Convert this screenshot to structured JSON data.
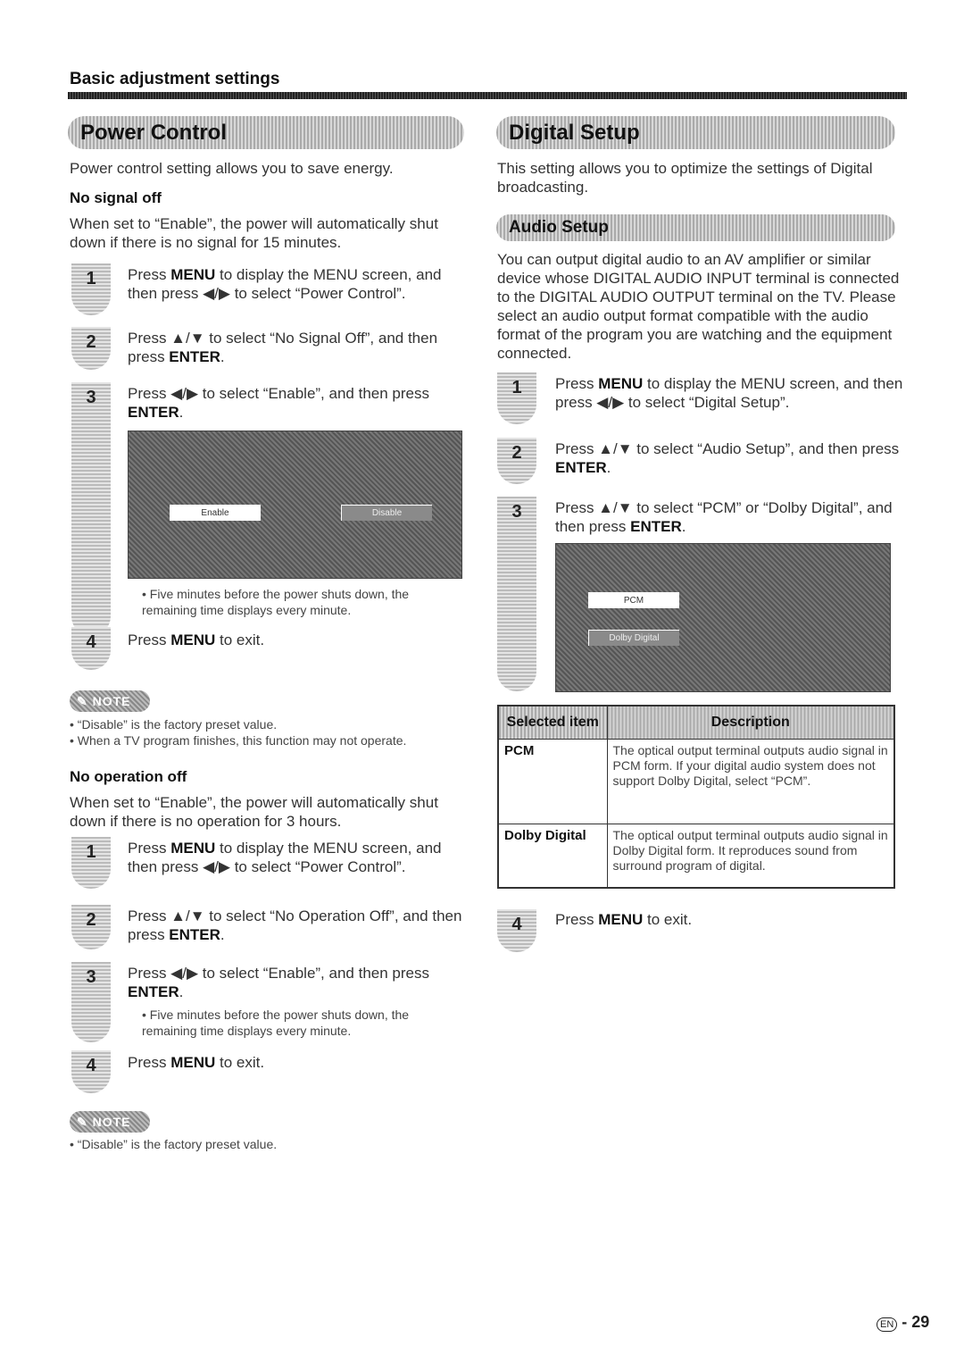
{
  "header": {
    "title": "Basic adjustment settings"
  },
  "power_control": {
    "title": "Power Control",
    "intro": "Power control setting allows you to save energy.",
    "no_signal": {
      "heading": "No signal off",
      "desc": "When set to “Enable”, the power will automatically shut down if there is no signal for 15 minutes.",
      "steps": [
        {
          "num": "1",
          "pre": "Press ",
          "key": "MENU",
          "post": " to display the MENU screen, and then press ◀/▶ to select “Power Control”."
        },
        {
          "num": "2",
          "pre": "Press ▲/▼ to select “No Signal Off”, and then press ",
          "key": "ENTER",
          "post": "."
        },
        {
          "num": "3",
          "pre": "Press ◀/▶ to select “Enable”, and then press ",
          "key": "ENTER",
          "post": "."
        },
        {
          "num": "4",
          "pre": "Press ",
          "key": "MENU",
          "post": " to exit."
        }
      ],
      "screen": {
        "option_on": "Enable",
        "option_off": "Disable"
      },
      "bullet": "Five minutes before the power shuts down, the remaining time displays every minute.",
      "note_label": "NOTE",
      "notes": [
        "“Disable” is the factory preset value.",
        "When a TV program finishes, this function may not operate."
      ]
    },
    "no_operation": {
      "heading": "No operation off",
      "desc": "When set to “Enable”, the power will automatically shut down if there is no operation for 3 hours.",
      "steps": [
        {
          "num": "1",
          "pre": "Press ",
          "key": "MENU",
          "post": " to display the MENU screen, and then press ◀/▶ to select “Power Control”."
        },
        {
          "num": "2",
          "pre": "Press ▲/▼ to select “No Operation Off”, and then press ",
          "key": "ENTER",
          "post": "."
        },
        {
          "num": "3",
          "pre": "Press ◀/▶ to select “Enable”, and then press ",
          "key": "ENTER",
          "post": "."
        },
        {
          "num": "4",
          "pre": "Press ",
          "key": "MENU",
          "post": " to exit."
        }
      ],
      "bullet": "Five minutes before the power shuts down, the remaining time displays every minute.",
      "note_label": "NOTE",
      "notes": [
        "“Disable” is the factory preset value."
      ]
    }
  },
  "digital_setup": {
    "title": "Digital Setup",
    "intro": "This setting allows you to optimize the settings of Digital broadcasting.",
    "audio_setup": {
      "title": "Audio Setup",
      "desc": "You can output digital audio to an AV amplifier or similar device whose DIGITAL AUDIO INPUT terminal is connected to the DIGITAL AUDIO OUTPUT terminal on the TV. Please select an audio output format compatible with the audio format of the program you are watching and the equipment connected.",
      "steps": [
        {
          "num": "1",
          "pre": "Press ",
          "key": "MENU",
          "post": " to display the MENU screen, and then press ◀/▶ to select “Digital Setup”."
        },
        {
          "num": "2",
          "pre": "Press ▲/▼ to select “Audio Setup”, and then press ",
          "key": "ENTER",
          "post": "."
        },
        {
          "num": "3",
          "pre": "Press ▲/▼ to select “PCM” or “Dolby Digital”, and then press ",
          "key": "ENTER",
          "post": "."
        },
        {
          "num": "4",
          "pre": "Press ",
          "key": "MENU",
          "post": " to exit."
        }
      ],
      "screen": {
        "option_on": "PCM",
        "option_off": "Dolby Digital"
      },
      "table": {
        "headers": [
          "Selected item",
          "Description"
        ],
        "rows": [
          {
            "item": "PCM",
            "desc": "The optical output terminal outputs audio signal in PCM form. If your digital audio system does not support Dolby Digital, select “PCM”."
          },
          {
            "item": "Dolby Digital",
            "desc": "The optical output terminal outputs audio signal in Dolby Digital form. It reproduces sound from surround program of digital."
          }
        ]
      }
    }
  },
  "footer": {
    "lang": "EN",
    "page": "- 29"
  }
}
